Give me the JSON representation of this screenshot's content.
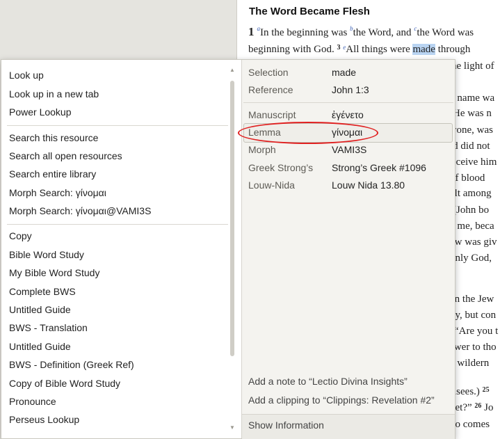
{
  "document": {
    "title": "The Word Became Flesh",
    "chapter": "1",
    "line1_a": "In the beginning was ",
    "line1_b": "the Word, and ",
    "line1_c": "the Word was",
    "line2_a": "beginning with God. ",
    "verse3": "3",
    "line2_b": "All things were ",
    "line2_hl": "made",
    "line2_c": " through",
    "frags": [
      "he light of",
      "e name wa",
      "He was n",
      "yone, was",
      "ld did not",
      "eceive him",
      "of blood",
      "elt among",
      "(John bo",
      "e me, beca",
      "aw was giv",
      "only God,",
      "en the Jew",
      "ny, but con",
      "“Are you t",
      "swer to tho",
      "e wildern",
      "risees.)",
      "25",
      "het?”",
      "26",
      "Jo",
      "ho comes"
    ]
  },
  "menu": {
    "items_group1": [
      "Look up",
      "Look up in a new tab",
      "Power Lookup"
    ],
    "items_group2": [
      "Search this resource",
      "Search all open resources",
      "Search entire library",
      "Morph Search: γίνομαι",
      "Morph Search: γίνομαι@VAMI3S"
    ],
    "items_group3": [
      "Copy",
      "Bible Word Study",
      "My Bible Word Study",
      "Complete BWS",
      "Untitled Guide",
      "BWS - Translation",
      "Untitled Guide",
      "BWS - Definition (Greek Ref)",
      "Copy of Bible Word Study",
      "Pronounce",
      "Perseus Lookup"
    ]
  },
  "info": {
    "rows": [
      {
        "label": "Selection",
        "value": "made"
      },
      {
        "label": "Reference",
        "value": "John 1:3"
      },
      {
        "label": "Manuscript",
        "value": "ἐγένετο"
      },
      {
        "label": "Lemma",
        "value": "γίνομαι"
      },
      {
        "label": "Morph",
        "value": "VAMI3S"
      },
      {
        "label": "Greek Strong’s",
        "value": "Strong’s Greek #1096"
      },
      {
        "label": "Louw-Nida",
        "value": "Louw Nida 13.80"
      }
    ],
    "actions": [
      "Add a note to “Lectio Divina Insights”",
      "Add a clipping to “Clippings: Revelation #2”"
    ],
    "show_information": "Show Information"
  },
  "colors": {
    "highlight": "#b9d4f2",
    "annotation": "#e02020",
    "footnote": "#3b5fb3"
  }
}
